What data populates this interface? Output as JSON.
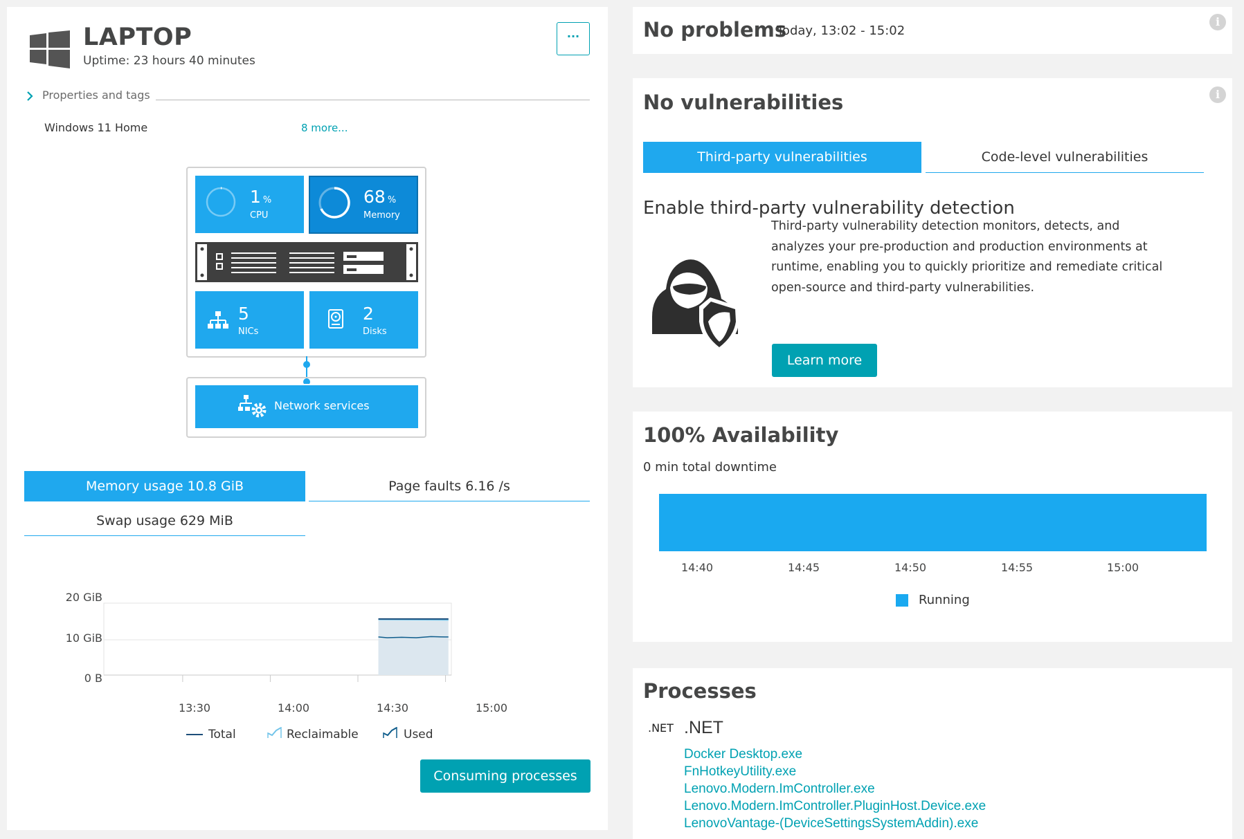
{
  "host": {
    "name": "LAPTOP",
    "uptime": "Uptime: 23 hours 40 minutes",
    "more_button": "···",
    "properties_label": "Properties and tags",
    "os": "Windows 11 Home",
    "more_link": "8 more..."
  },
  "infographic": {
    "cpu": {
      "value": "1",
      "unit": "%",
      "label": "CPU",
      "level": 0.01
    },
    "memory": {
      "value": "68",
      "unit": "%",
      "label": "Memory",
      "level": 0.68
    },
    "nics": {
      "value": "5",
      "label": "NICs"
    },
    "disks": {
      "value": "2",
      "label": "Disks"
    },
    "network_services": "Network services"
  },
  "memory_tabs": {
    "memory_usage": "Memory usage 10.8 GiB",
    "page_faults": "Page faults 6.16 /s",
    "swap_usage": "Swap usage 629 MiB"
  },
  "chart_data": {
    "type": "area",
    "y_ticks": [
      "20 GiB",
      "10 GiB",
      "0 B"
    ],
    "x_ticks": [
      "13:30",
      "14:00",
      "14:30",
      "15:00"
    ],
    "ylim": [
      0,
      20
    ],
    "xlim": [
      "13:03",
      "15:02"
    ],
    "series": [
      {
        "name": "Total",
        "x": [
          "14:37",
          "15:01"
        ],
        "values": [
          15.9,
          15.9
        ]
      },
      {
        "name": "Reclaimable",
        "x": [
          "14:37",
          "15:01"
        ],
        "values": [
          15.7,
          15.6
        ]
      },
      {
        "name": "Used",
        "x": [
          "14:37",
          "14:40",
          "14:45",
          "14:50",
          "14:55",
          "15:00",
          "15:01"
        ],
        "values": [
          10.8,
          10.6,
          10.7,
          10.6,
          10.9,
          10.8,
          10.8
        ]
      }
    ],
    "legend": [
      "Total",
      "Reclaimable",
      "Used"
    ],
    "colors": {
      "total": "#1d4e7a",
      "reclaimable": "#74c5ea",
      "used": "#0f5d8c",
      "fill": "#dce7ef"
    }
  },
  "consuming_processes_button": "Consuming processes",
  "problems": {
    "title": "No problems",
    "timeframe": "Today, 13:02 - 15:02"
  },
  "vulnerabilities": {
    "title": "No vulnerabilities",
    "tab_third_party": "Third-party vulnerabilities",
    "tab_code_level": "Code-level vulnerabilities",
    "heading": "Enable third-party vulnerability detection",
    "description_lines": [
      "Third-party vulnerability detection monitors, detects, and",
      "analyzes your pre-production and production environments at",
      "runtime, enabling you to quickly prioritize and remediate critical",
      "open-source and third-party vulnerabilities."
    ],
    "learn_more": "Learn more"
  },
  "availability": {
    "title": "100% Availability",
    "downtime": "0 min total downtime",
    "x_ticks": [
      "14:40",
      "14:45",
      "14:50",
      "14:55",
      "15:00"
    ],
    "legend": "Running",
    "color": "#1aa9f0"
  },
  "processes": {
    "title": "Processes",
    "group_icon": ".NET",
    "group_name": ".NET",
    "items": [
      "Docker Desktop.exe",
      "FnHotkeyUtility.exe",
      "Lenovo.Modern.ImController.exe",
      "Lenovo.Modern.ImController.PluginHost.Device.exe",
      "LenovoVantage-(DeviceSettingsSystemAddin).exe"
    ]
  }
}
